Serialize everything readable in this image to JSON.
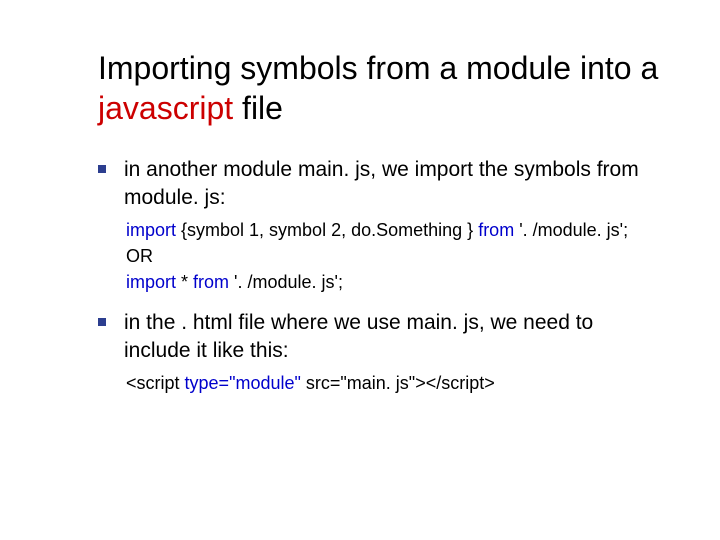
{
  "title_pre": "Importing symbols from a module into a ",
  "title_red": "javascript",
  "title_post": " file",
  "b1": "in another module main. js, we import the symbols from module. js:",
  "code1_kw1": "import",
  "code1_mid": " {symbol 1, symbol 2, do.Something } ",
  "code1_kw2": "from",
  "code1_end": " '. /module. js';",
  "code_or": "OR",
  "code2_kw1": "import",
  "code2_mid": " * ",
  "code2_kw2": "from",
  "code2_end": " '. /module. js';",
  "b2": "in the . html file where we use main. js, we need to include it like this:",
  "script_open": "<script ",
  "script_attr": "type=\"module\"",
  "script_rest": " src=\"main. js\"></script>"
}
